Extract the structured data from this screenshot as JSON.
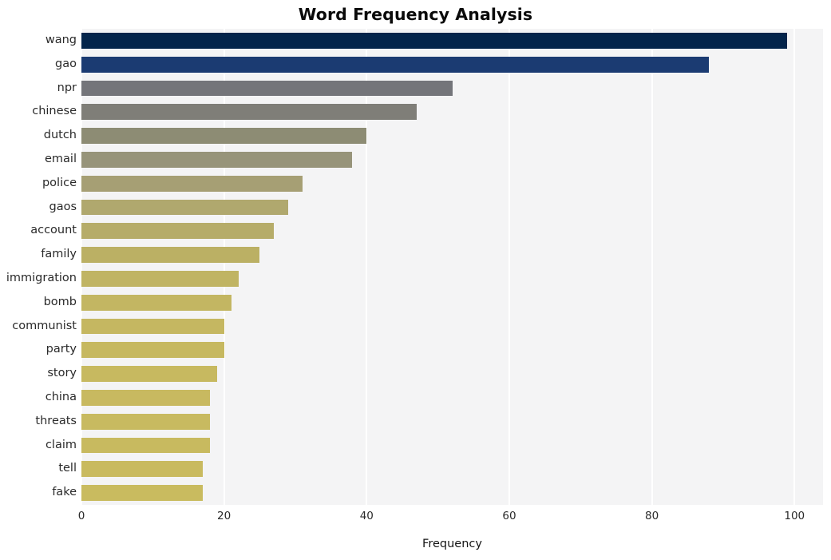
{
  "chart_data": {
    "type": "bar",
    "orientation": "horizontal",
    "title": "Word Frequency Analysis",
    "xlabel": "Frequency",
    "ylabel": "",
    "xlim": [
      0,
      104
    ],
    "xticks": [
      0,
      20,
      40,
      60,
      80,
      100
    ],
    "xtick_labels": [
      "0",
      "20",
      "40",
      "60",
      "80",
      "100"
    ],
    "grid": "vertical-white-on-gray",
    "legend": "none",
    "categories": [
      "wang",
      "gao",
      "npr",
      "chinese",
      "dutch",
      "email",
      "police",
      "gaos",
      "account",
      "family",
      "immigration",
      "bomb",
      "communist",
      "party",
      "story",
      "china",
      "threats",
      "claim",
      "tell",
      "fake"
    ],
    "values": [
      99,
      88,
      52,
      47,
      40,
      38,
      31,
      29,
      27,
      25,
      22,
      21,
      20,
      20,
      19,
      18,
      18,
      18,
      17,
      17
    ],
    "bar_colors": [
      "#04254b",
      "#1b3b72",
      "#74757a",
      "#7f7e78",
      "#8d8c74",
      "#97947a",
      "#a69f74",
      "#b0a86e",
      "#b6ac69",
      "#bbb064",
      "#c0b463",
      "#c3b662",
      "#c5b761",
      "#c6b860",
      "#c7b960",
      "#c8b960",
      "#c8ba60",
      "#c8ba5f",
      "#c9ba5f",
      "#c9bb5f"
    ],
    "background_color": "#f4f4f5",
    "figure_color": "#ffffff",
    "gridline_color": "#ffffff",
    "text_color": "#2a2a2a"
  }
}
